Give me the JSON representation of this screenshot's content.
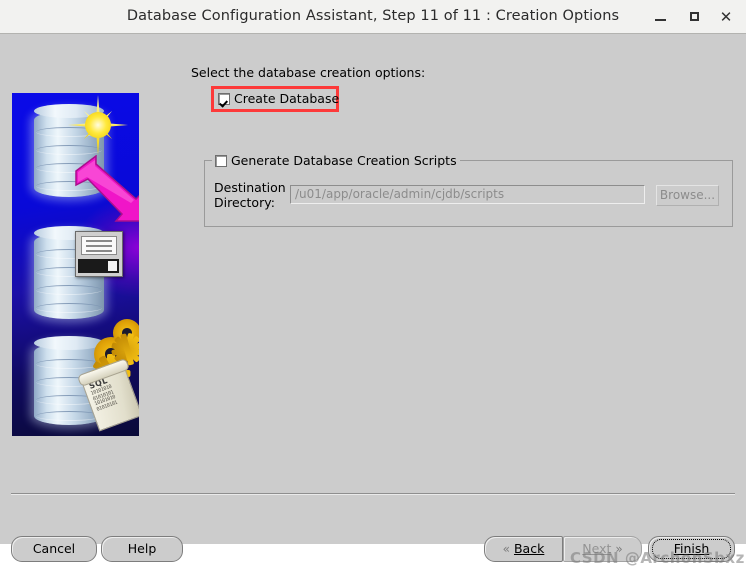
{
  "window": {
    "title": "Database Configuration Assistant, Step 11 of 11 : Creation Options",
    "minimize_label": "–",
    "maximize_label": "□",
    "close_label": "×"
  },
  "form": {
    "intro_label": "Select the database creation options:",
    "create_database": {
      "label": "Create Database",
      "checked": true,
      "highlight_color": "#fd3a3a"
    },
    "scripts_group": {
      "label": "Generate Database Creation Scripts",
      "checked": false,
      "destination_label": "Destination",
      "destination_label_line2": "Directory:",
      "destination_value": "/u01/app/oracle/admin/cjdb/scripts",
      "browse_label": "Browse..."
    }
  },
  "sidebar": {
    "graphic_name": "oracle-dbca-database-artwork",
    "scroll_text": "SQL",
    "scroll_bits_1": "10101010",
    "scroll_bits_2": "01010101",
    "scroll_bits_3": "10101010",
    "scroll_bits_4": "01010101",
    "background_top_color": "#0a0ae8",
    "background_bottom_color": "#0a0a38",
    "arrow_color": "#f015c8"
  },
  "buttons": {
    "cancel": "Cancel",
    "help": "Help",
    "back": "Back",
    "next": "Next",
    "finish": "Finish",
    "back_chevron": "«",
    "next_chevron": "»"
  },
  "watermark": {
    "text": "CSDN @ArchonSbxz"
  }
}
